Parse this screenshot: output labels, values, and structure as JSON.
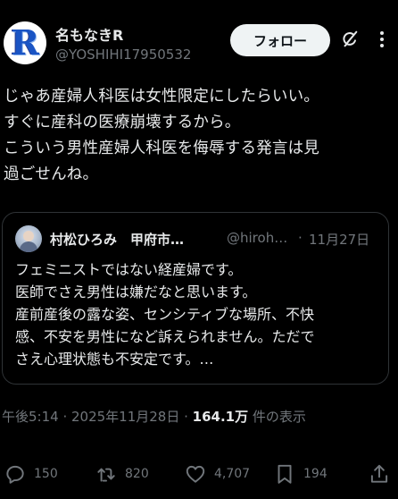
{
  "author": {
    "avatar_letter": "R",
    "name": "名もなきR",
    "handle": "@YOSHIHI17950532"
  },
  "header": {
    "follow_label": "フォロー",
    "grok_icon": "grok-icon",
    "more_icon": "more-icon"
  },
  "tweet": {
    "text": "じゃあ産婦人科医は女性限定にしたらいい。\nすぐに産科の医療崩壊するから。\nこういう男性産婦人科医を侮辱する発言は見\n過ごせんね。"
  },
  "quote": {
    "name": "村松ひろみ　甲府市…",
    "handle": "@hiroh…",
    "dot": "·",
    "date": "11月27日",
    "text": "フェミニストではない経産婦です。\n医師でさえ男性は嫌だなと思います。\n産前産後の露な姿、センシティブな場所、不快\n感、不安を男性になど訴えられません。ただで\nさえ心理状態も不安定です。…"
  },
  "meta": {
    "timestamp": "午後5:14 · 2025年11月28日 · ",
    "views": "164.1万",
    "views_suffix": " 件の表示"
  },
  "actions": {
    "replies": "150",
    "reposts": "820",
    "likes": "4,707",
    "bookmarks": "194"
  },
  "colors": {
    "background": "#000000",
    "text": "#e7e9ea",
    "secondary": "#71767b",
    "border": "#2f3336",
    "follow_bg": "#eff3f4"
  }
}
